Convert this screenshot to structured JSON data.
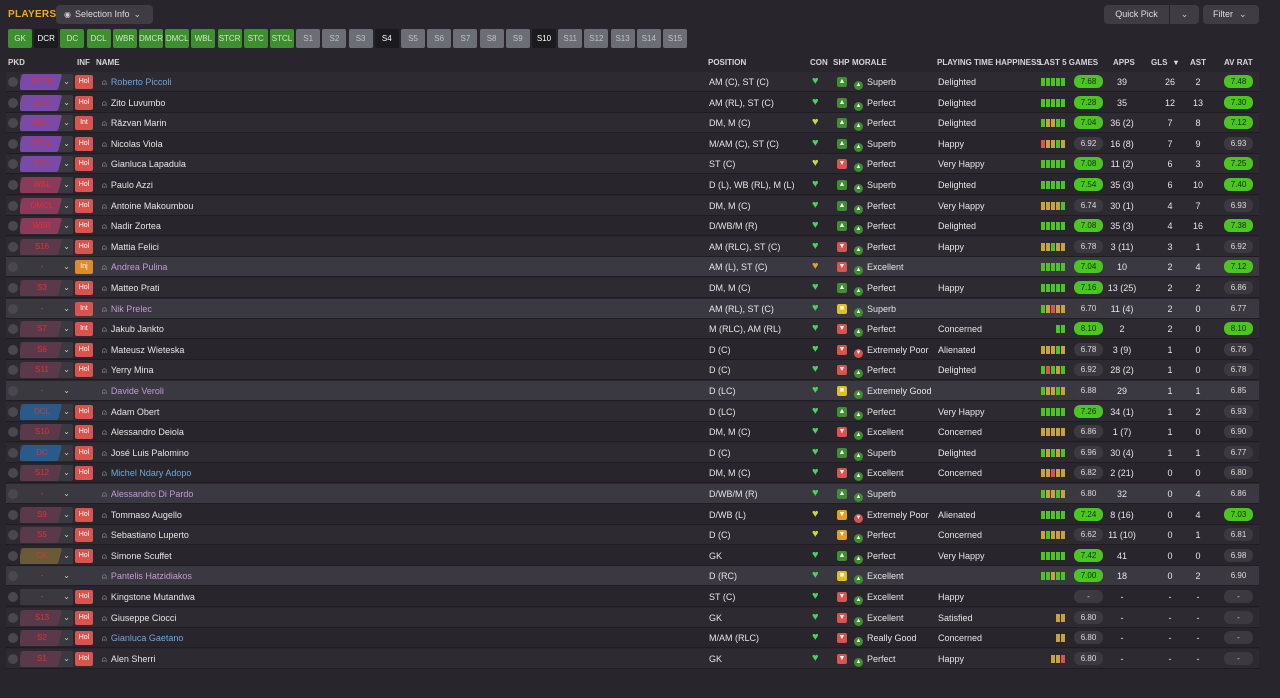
{
  "topbar": {
    "title": "PLAYERS",
    "selection_info": "Selection Info",
    "quick_pick": "Quick Pick",
    "filter": "Filter"
  },
  "positions": [
    {
      "label": "GK",
      "state": "green"
    },
    {
      "label": "DCR",
      "state": "selected"
    },
    {
      "label": "DC",
      "state": "green"
    },
    {
      "label": "DCL",
      "state": "green"
    },
    {
      "label": "WBR",
      "state": "green"
    },
    {
      "label": "DMCR",
      "state": "green"
    },
    {
      "label": "DMCL",
      "state": "green"
    },
    {
      "label": "WBL",
      "state": "green"
    },
    {
      "label": "STCR",
      "state": "green"
    },
    {
      "label": "STC",
      "state": "green"
    },
    {
      "label": "STCL",
      "state": "green"
    },
    {
      "label": "S1",
      "state": "grey"
    },
    {
      "label": "S2",
      "state": "grey"
    },
    {
      "label": "S3",
      "state": "grey"
    },
    {
      "label": "S4",
      "state": "selected"
    },
    {
      "label": "S5",
      "state": "grey"
    },
    {
      "label": "S6",
      "state": "grey"
    },
    {
      "label": "S7",
      "state": "grey"
    },
    {
      "label": "S8",
      "state": "grey"
    },
    {
      "label": "S9",
      "state": "grey"
    },
    {
      "label": "S10",
      "state": "selected"
    },
    {
      "label": "S11",
      "state": "grey"
    },
    {
      "label": "S12",
      "state": "grey"
    },
    {
      "label": "S13",
      "state": "grey"
    },
    {
      "label": "S14",
      "state": "grey"
    },
    {
      "label": "S15",
      "state": "grey"
    }
  ],
  "columns": {
    "pkd": "PKD",
    "inf": "INF",
    "name": "NAME",
    "position": "POSITION",
    "con": "CON",
    "shp": "SHP",
    "morale": "MORALE",
    "pth": "PLAYING TIME HAPPINESS",
    "last5": "LAST 5 GAMES",
    "apps": "APPS",
    "gls": "GLS",
    "ast": "AST",
    "avrat": "AV RAT"
  },
  "colors": {
    "green": "#3e8f2f",
    "rating_green": "#4cc520",
    "rating_grey": "#3c3a40",
    "hol": "#d9534f",
    "inj": "#e08b2a",
    "link": "#6fa8dc",
    "loan": "#c49ad6"
  },
  "players": [
    {
      "sel": "STCR",
      "pill": "#7a4aa8",
      "inf": "Hol",
      "name": "Roberto Piccoli",
      "nameColor": "#6fa8dc",
      "pos": "AM (C), ST (C)",
      "shp": "up",
      "morale": "Superb",
      "pth": "Delighted",
      "form": [
        "g",
        "g",
        "g",
        "g",
        "g"
      ],
      "l5": "7.68",
      "l5c": "g",
      "apps": "39",
      "gls": "26",
      "ast": "2",
      "avr": "7.48",
      "avrc": "g"
    },
    {
      "sel": "STC",
      "pill": "#7a4aa8",
      "inf": "Hol",
      "name": "Zito Luvumbo",
      "nameColor": "#e6e6e6",
      "pos": "AM (RL), ST (C)",
      "shp": "up",
      "morale": "Perfect",
      "pth": "Delighted",
      "form": [
        "g",
        "g",
        "g",
        "g",
        "g"
      ],
      "l5": "7.28",
      "l5c": "g",
      "apps": "35",
      "gls": "12",
      "ast": "13",
      "avr": "7.30",
      "avrc": "g"
    },
    {
      "sel": "DM...",
      "pill": "#7a4aa8",
      "inf": "Int",
      "name": "Răzvan Marin",
      "nameColor": "#e6e6e6",
      "pos": "DM, M (C)",
      "shp": "up",
      "morale": "Perfect",
      "pth": "Delighted",
      "form": [
        "g",
        "o",
        "o",
        "g",
        "g"
      ],
      "l5": "7.04",
      "l5c": "g",
      "apps": "36 (2)",
      "gls": "7",
      "ast": "8",
      "avr": "7.12",
      "avrc": "g"
    },
    {
      "sel": "STCL",
      "pill": "#7a4aa8",
      "inf": "Hol",
      "name": "Nicolas Viola",
      "nameColor": "#e6e6e6",
      "pos": "M/AM (C), ST (C)",
      "shp": "up",
      "morale": "Superb",
      "pth": "Happy",
      "form": [
        "r",
        "o",
        "o",
        "g",
        "o"
      ],
      "l5": "6.92",
      "l5c": "x",
      "apps": "16 (8)",
      "gls": "7",
      "ast": "9",
      "avr": "6.93",
      "avrc": "x"
    },
    {
      "sel": "DCL",
      "pill": "#7a4aa8",
      "inf": "Hol",
      "name": "Gianluca Lapadula",
      "nameColor": "#e6e6e6",
      "pos": "ST (C)",
      "shp": "down",
      "morale": "Perfect",
      "pth": "Very Happy",
      "form": [
        "g",
        "g",
        "g",
        "g",
        "g"
      ],
      "l5": "7.08",
      "l5c": "g",
      "apps": "11 (2)",
      "gls": "6",
      "ast": "3",
      "avr": "7.25",
      "avrc": "g"
    },
    {
      "sel": "WBL",
      "pill": "#8a3a5a",
      "inf": "Hol",
      "name": "Paulo Azzi",
      "nameColor": "#e6e6e6",
      "pos": "D (L), WB (RL), M (L)",
      "shp": "up",
      "morale": "Superb",
      "pth": "Delighted",
      "form": [
        "g",
        "g",
        "g",
        "g",
        "g"
      ],
      "l5": "7.54",
      "l5c": "g",
      "apps": "35 (3)",
      "gls": "6",
      "ast": "10",
      "avr": "7.40",
      "avrc": "g"
    },
    {
      "sel": "DMCL",
      "pill": "#8a3a5a",
      "inf": "Hol",
      "name": "Antoine Makoumbou",
      "nameColor": "#e6e6e6",
      "pos": "DM, M (C)",
      "shp": "up",
      "morale": "Perfect",
      "pth": "Very Happy",
      "form": [
        "o",
        "o",
        "o",
        "o",
        "g"
      ],
      "l5": "6.74",
      "l5c": "x",
      "apps": "30 (1)",
      "gls": "4",
      "ast": "7",
      "avr": "6.93",
      "avrc": "x"
    },
    {
      "sel": "WBR",
      "pill": "#8a3a5a",
      "inf": "Hol",
      "name": "Nadir Zortea",
      "nameColor": "#e6e6e6",
      "pos": "D/WB/M (R)",
      "shp": "up",
      "morale": "Perfect",
      "pth": "Delighted",
      "form": [
        "g",
        "g",
        "g",
        "g",
        "g"
      ],
      "l5": "7.08",
      "l5c": "g",
      "apps": "35 (3)",
      "gls": "4",
      "ast": "16",
      "avr": "7.38",
      "avrc": "g"
    },
    {
      "sel": "S16",
      "pill": "#5a3a4a",
      "inf": "Hol",
      "name": "Mattia Felici",
      "nameColor": "#e6e6e6",
      "pos": "AM (RLC), ST (C)",
      "shp": "down",
      "morale": "Perfect",
      "pth": "Happy",
      "form": [
        "o",
        "o",
        "g",
        "o",
        "o"
      ],
      "l5": "6.78",
      "l5c": "x",
      "apps": "3 (11)",
      "gls": "3",
      "ast": "1",
      "avr": "6.92",
      "avrc": "x"
    },
    {
      "sel": "-",
      "pill": "#3b3940",
      "inf": "Inj",
      "name": "Andrea Pulina",
      "nameColor": "#c49ad6",
      "pos": "AM (L), ST (C)",
      "shp": "down",
      "morale": "Excellent",
      "pth": "",
      "form": [
        "g",
        "g",
        "g",
        "g",
        "g"
      ],
      "l5": "7.04",
      "l5c": "g",
      "apps": "10",
      "gls": "2",
      "ast": "4",
      "avr": "7.12",
      "avrc": "g",
      "avail": true
    },
    {
      "sel": "S3",
      "pill": "#5a3a4a",
      "inf": "Hol",
      "name": "Matteo Prati",
      "nameColor": "#e6e6e6",
      "pos": "DM, M (C)",
      "shp": "up",
      "morale": "Perfect",
      "pth": "Happy",
      "form": [
        "g",
        "g",
        "g",
        "g",
        "g"
      ],
      "l5": "7.16",
      "l5c": "g",
      "apps": "13 (25)",
      "gls": "2",
      "ast": "2",
      "avr": "6.86",
      "avrc": "x"
    },
    {
      "sel": "-",
      "pill": "#3b3940",
      "inf": "Int",
      "name": "Nik Prelec",
      "nameColor": "#c49ad6",
      "pos": "AM (RL), ST (C)",
      "shp": "flat",
      "morale": "Superb",
      "pth": "",
      "form": [
        "g",
        "o",
        "r",
        "o",
        "o"
      ],
      "l5": "6.70",
      "l5c": "x",
      "apps": "11 (4)",
      "gls": "2",
      "ast": "0",
      "avr": "6.77",
      "avrc": "x",
      "avail": true
    },
    {
      "sel": "S7",
      "pill": "#5a3a4a",
      "inf": "Int",
      "name": "Jakub Jankto",
      "nameColor": "#e6e6e6",
      "pos": "M (RLC), AM (RL)",
      "shp": "down",
      "morale": "Perfect",
      "pth": "Concerned",
      "form": [
        "g",
        "g"
      ],
      "l5": "8.10",
      "l5c": "g",
      "apps": "2",
      "gls": "2",
      "ast": "0",
      "avr": "8.10",
      "avrc": "g"
    },
    {
      "sel": "S6",
      "pill": "#5a3a4a",
      "inf": "Hol",
      "name": "Mateusz Wieteska",
      "nameColor": "#e6e6e6",
      "pos": "D (C)",
      "shp": "down",
      "morale": "Extremely Poor",
      "pth": "Alienated",
      "form": [
        "o",
        "o",
        "o",
        "g",
        "o"
      ],
      "l5": "6.78",
      "l5c": "x",
      "apps": "3 (9)",
      "gls": "1",
      "ast": "0",
      "avr": "6.76",
      "avrc": "x"
    },
    {
      "sel": "S11",
      "pill": "#5a3a4a",
      "inf": "Hol",
      "name": "Yerry Mina",
      "nameColor": "#e6e6e6",
      "pos": "D (C)",
      "shp": "down",
      "morale": "Perfect",
      "pth": "Delighted",
      "form": [
        "g",
        "r",
        "g",
        "o",
        "g"
      ],
      "l5": "6.92",
      "l5c": "x",
      "apps": "28 (2)",
      "gls": "1",
      "ast": "0",
      "avr": "6.78",
      "avrc": "x"
    },
    {
      "sel": "-",
      "pill": "#3b3940",
      "inf": "",
      "name": "Davide Veroli",
      "nameColor": "#c49ad6",
      "pos": "D (LC)",
      "shp": "flat",
      "morale": "Extremely Good",
      "pth": "",
      "form": [
        "g",
        "o",
        "o",
        "g",
        "o"
      ],
      "l5": "6.88",
      "l5c": "x",
      "apps": "29",
      "gls": "1",
      "ast": "1",
      "avr": "6.85",
      "avrc": "x",
      "avail": true
    },
    {
      "sel": "DCL",
      "pill": "#2a5a8a",
      "inf": "Hol",
      "name": "Adam Obert",
      "nameColor": "#e6e6e6",
      "pos": "D (LC)",
      "shp": "up",
      "morale": "Perfect",
      "pth": "Very Happy",
      "form": [
        "g",
        "g",
        "g",
        "g",
        "g"
      ],
      "l5": "7.26",
      "l5c": "g",
      "apps": "34 (1)",
      "gls": "1",
      "ast": "2",
      "avr": "6.93",
      "avrc": "x"
    },
    {
      "sel": "S10",
      "pill": "#5a3a4a",
      "inf": "Hol",
      "name": "Alessandro Deiola",
      "nameColor": "#e6e6e6",
      "pos": "DM, M (C)",
      "shp": "down",
      "morale": "Excellent",
      "pth": "Concerned",
      "form": [
        "o",
        "o",
        "o",
        "o",
        "o"
      ],
      "l5": "6.86",
      "l5c": "x",
      "apps": "1 (7)",
      "gls": "1",
      "ast": "0",
      "avr": "6.90",
      "avrc": "x"
    },
    {
      "sel": "DC",
      "pill": "#2a5a8a",
      "inf": "Hol",
      "name": "José Luis Palomino",
      "nameColor": "#e6e6e6",
      "pos": "D (C)",
      "shp": "up",
      "morale": "Superb",
      "pth": "Delighted",
      "form": [
        "g",
        "o",
        "g",
        "o",
        "g"
      ],
      "l5": "6.96",
      "l5c": "x",
      "apps": "30 (4)",
      "gls": "1",
      "ast": "1",
      "avr": "6.77",
      "avrc": "x"
    },
    {
      "sel": "S12",
      "pill": "#5a3a4a",
      "inf": "Hol",
      "name": "Michel Ndary Adopo",
      "nameColor": "#6fa8dc",
      "pos": "DM, M (C)",
      "shp": "down",
      "morale": "Excellent",
      "pth": "Concerned",
      "form": [
        "o",
        "o",
        "r",
        "o",
        "o"
      ],
      "l5": "6.82",
      "l5c": "x",
      "apps": "2 (21)",
      "gls": "0",
      "ast": "0",
      "avr": "6.80",
      "avrc": "x"
    },
    {
      "sel": "-",
      "pill": "#3b3940",
      "inf": "",
      "name": "Alessandro Di Pardo",
      "nameColor": "#c49ad6",
      "pos": "D/WB/M (R)",
      "shp": "up",
      "morale": "Superb",
      "pth": "",
      "form": [
        "g",
        "o",
        "o",
        "g",
        "o"
      ],
      "l5": "6.80",
      "l5c": "x",
      "apps": "32",
      "gls": "0",
      "ast": "4",
      "avr": "6.86",
      "avrc": "x",
      "avail": true
    },
    {
      "sel": "S9",
      "pill": "#5a3a4a",
      "inf": "Hol",
      "name": "Tommaso Augello",
      "nameColor": "#e6e6e6",
      "pos": "D/WB (L)",
      "shp": "downy",
      "morale": "Extremely Poor",
      "pth": "Alienated",
      "form": [
        "g",
        "g",
        "g",
        "g",
        "g"
      ],
      "l5": "7.24",
      "l5c": "g",
      "apps": "8 (16)",
      "gls": "0",
      "ast": "4",
      "avr": "7.03",
      "avrc": "g"
    },
    {
      "sel": "S5",
      "pill": "#5a3a4a",
      "inf": "Hol",
      "name": "Sebastiano Luperto",
      "nameColor": "#e6e6e6",
      "pos": "D (C)",
      "shp": "downy",
      "morale": "Perfect",
      "pth": "Concerned",
      "form": [
        "o",
        "g",
        "o",
        "o",
        "o"
      ],
      "l5": "6.62",
      "l5c": "x",
      "apps": "11 (10)",
      "gls": "0",
      "ast": "1",
      "avr": "6.81",
      "avrc": "x"
    },
    {
      "sel": "GK",
      "pill": "#6a5a3a",
      "inf": "Hol",
      "name": "Simone Scuffet",
      "nameColor": "#e6e6e6",
      "pos": "GK",
      "shp": "up",
      "morale": "Perfect",
      "pth": "Very Happy",
      "form": [
        "g",
        "g",
        "g",
        "g",
        "g"
      ],
      "l5": "7.42",
      "l5c": "g",
      "apps": "41",
      "gls": "0",
      "ast": "0",
      "avr": "6.98",
      "avrc": "x"
    },
    {
      "sel": "-",
      "pill": "#3b3940",
      "inf": "",
      "name": "Pantelis Hatzidiakos",
      "nameColor": "#c49ad6",
      "pos": "D (RC)",
      "shp": "flat",
      "morale": "Excellent",
      "pth": "",
      "form": [
        "g",
        "g",
        "o",
        "g",
        "g"
      ],
      "l5": "7.00",
      "l5c": "g",
      "apps": "18",
      "gls": "0",
      "ast": "2",
      "avr": "6.90",
      "avrc": "x",
      "avail": true
    },
    {
      "sel": "-",
      "pill": "#3b3940",
      "inf": "Hol",
      "name": "Kingstone Mutandwa",
      "nameColor": "#e6e6e6",
      "pos": "ST (C)",
      "shp": "down",
      "morale": "Excellent",
      "pth": "Happy",
      "form": [],
      "l5": "-",
      "l5c": "x",
      "apps": "-",
      "gls": "-",
      "ast": "-",
      "avr": "-",
      "avrc": "x"
    },
    {
      "sel": "S13",
      "pill": "#5a3a4a",
      "inf": "Hol",
      "name": "Giuseppe Ciocci",
      "nameColor": "#e6e6e6",
      "pos": "GK",
      "shp": "down",
      "morale": "Excellent",
      "pth": "Satisfied",
      "form": [
        "o",
        "o"
      ],
      "l5": "6.80",
      "l5c": "x",
      "apps": "-",
      "gls": "-",
      "ast": "-",
      "avr": "-",
      "avrc": "x"
    },
    {
      "sel": "S2",
      "pill": "#5a3a4a",
      "inf": "Hol",
      "name": "Gianluca Gaetano",
      "nameColor": "#6fa8dc",
      "pos": "M/AM (RLC)",
      "shp": "down",
      "morale": "Really Good",
      "pth": "Concerned",
      "form": [
        "o",
        "o"
      ],
      "l5": "6.80",
      "l5c": "x",
      "apps": "-",
      "gls": "-",
      "ast": "-",
      "avr": "-",
      "avrc": "x"
    },
    {
      "sel": "S1",
      "pill": "#5a3a4a",
      "inf": "Hol",
      "name": "Alen Sherri",
      "nameColor": "#e6e6e6",
      "pos": "GK",
      "shp": "down",
      "morale": "Perfect",
      "pth": "Happy",
      "form": [
        "o",
        "o",
        "r"
      ],
      "l5": "6.80",
      "l5c": "x",
      "apps": "-",
      "gls": "-",
      "ast": "-",
      "avr": "-",
      "avrc": "x"
    }
  ]
}
